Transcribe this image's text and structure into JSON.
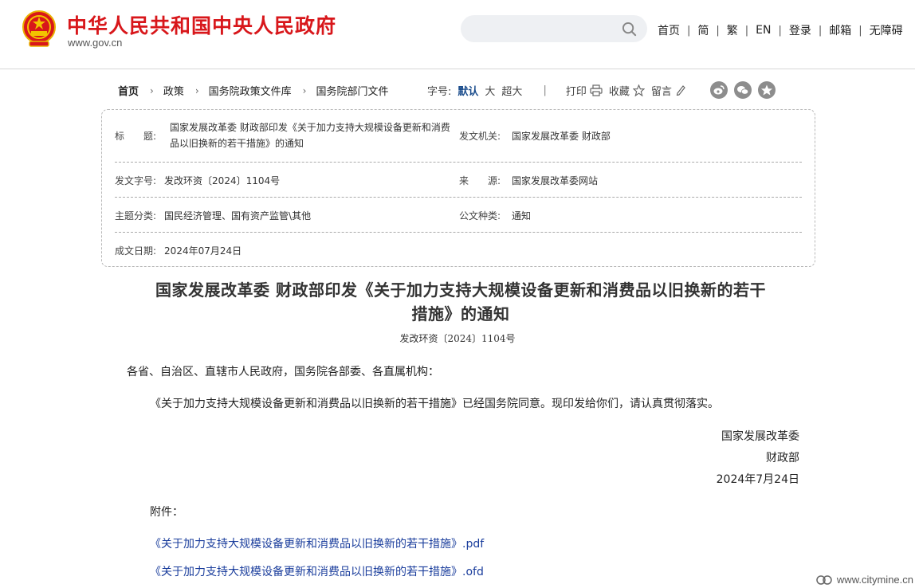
{
  "header": {
    "site_title": "中华人民共和国中央人民政府",
    "site_domain": "www.gov.cn",
    "search_placeholder": "",
    "nav": [
      "首页",
      "简",
      "繁",
      "EN",
      "登录",
      "邮箱",
      "无障碍"
    ]
  },
  "breadcrumb": [
    "首页",
    "政策",
    "国务院政策文件库",
    "国务院部门文件"
  ],
  "font_size": {
    "label": "字号:",
    "options": [
      "默认",
      "大",
      "超大"
    ],
    "selected": "默认"
  },
  "tools": {
    "print": "打印",
    "favorite": "收藏",
    "comment": "留言"
  },
  "share_icons": [
    "weibo-icon",
    "wechat-icon",
    "favorite-star-icon"
  ],
  "info": {
    "title_label": "标　　题:",
    "title_value": "国家发展改革委 财政部印发《关于加力支持大规模设备更新和消费品以旧换新的若干措施》的通知",
    "issuer_label": "发文机关:",
    "issuer_value": "国家发展改革委 财政部",
    "doc_no_label": "发文字号:",
    "doc_no_value": "发改环资〔2024〕1104号",
    "source_label": "来　　源:",
    "source_value": "国家发展改革委网站",
    "topic_label": "主题分类:",
    "topic_value": "国民经济管理、国有资产监管\\其他",
    "type_label": "公文种类:",
    "type_value": "通知",
    "date_label": "成文日期:",
    "date_value": "2024年07月24日"
  },
  "article": {
    "title_line1": "国家发展改革委 财政部印发《关于加力支持大规模设备更新和消费品以旧换新的若干",
    "title_line2": "措施》的通知",
    "doc_no": "发改环资〔2024〕1104号",
    "salutation": "各省、自治区、直辖市人民政府，国务院各部委、各直属机构：",
    "paragraph": "《关于加力支持大规模设备更新和消费品以旧换新的若干措施》已经国务院同意。现印发给你们，请认真贯彻落实。",
    "signatures": [
      "国家发展改革委",
      "财政部",
      "2024年7月24日"
    ],
    "attachment_label": "附件：",
    "attachments": [
      "《关于加力支持大规模设备更新和消费品以旧换新的若干措施》.pdf",
      "《关于加力支持大规模设备更新和消费品以旧换新的若干措施》.ofd"
    ]
  },
  "watermark": "www.citymine.cn",
  "colors": {
    "brand_red": "#d8171b",
    "link_blue": "#1a3d9c",
    "font_selected": "#1a4c8c"
  }
}
